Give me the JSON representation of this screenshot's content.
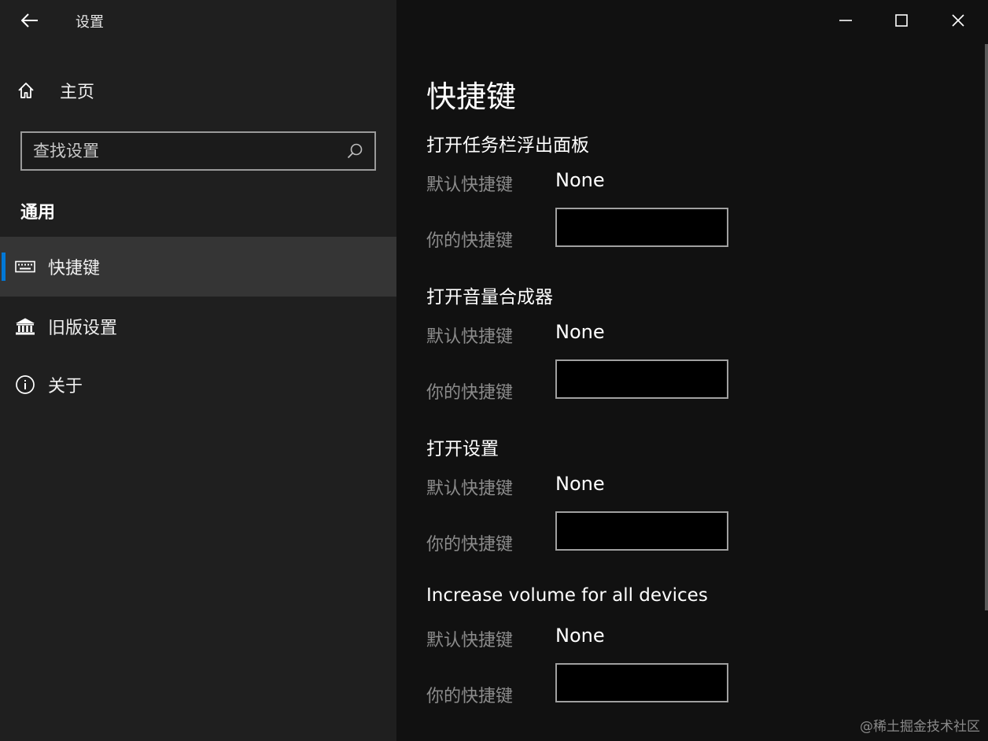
{
  "window": {
    "app_title": "设置",
    "accent_color": "#0078d7"
  },
  "sidebar": {
    "home_label": "主页",
    "search_placeholder": "查找设置",
    "section_header": "通用",
    "items": [
      {
        "label": "快捷键",
        "icon": "keyboard-icon",
        "selected": true
      },
      {
        "label": "旧版设置",
        "icon": "bank-icon",
        "selected": false
      },
      {
        "label": "关于",
        "icon": "info-icon",
        "selected": false
      }
    ]
  },
  "main": {
    "page_title": "快捷键",
    "default_label": "默认快捷键",
    "yours_label": "你的快捷键",
    "groups": [
      {
        "title": "打开任务栏浮出面板",
        "default_value": "None",
        "your_value": ""
      },
      {
        "title": "打开音量合成器",
        "default_value": "None",
        "your_value": ""
      },
      {
        "title": "打开设置",
        "default_value": "None",
        "your_value": ""
      },
      {
        "title": "Increase volume for all devices",
        "default_value": "None",
        "your_value": ""
      }
    ]
  },
  "watermark": "@稀土掘金技术社区"
}
